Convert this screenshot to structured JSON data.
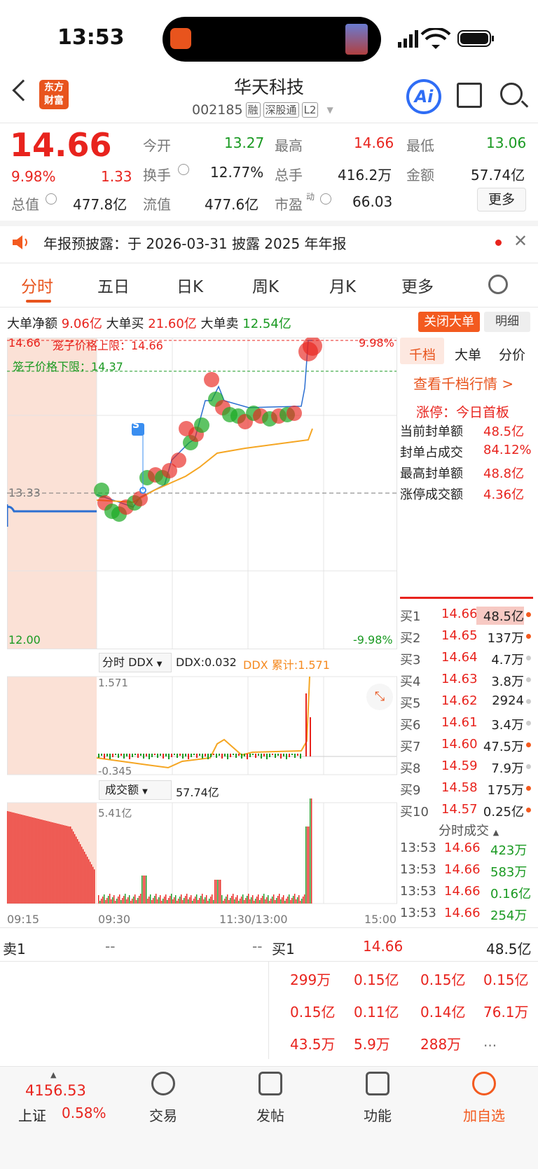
{
  "status": {
    "time": "13:53"
  },
  "header": {
    "title": "华天科技",
    "code": "002185",
    "tags": [
      "融",
      "深股通",
      "L2"
    ],
    "logo": "东方\n财富",
    "ai": "Ai"
  },
  "quote": {
    "price": "14.66",
    "pct": "9.98%",
    "chg": "1.33",
    "open_label": "今开",
    "open": "13.27",
    "high_label": "最高",
    "high": "14.66",
    "low_label": "最低",
    "low": "13.06",
    "turnover_label": "换手",
    "turnover": "12.77%",
    "vol_label": "总手",
    "vol": "416.2万",
    "amt_label": "金额",
    "amt": "57.74亿",
    "mcap_label": "总值",
    "mcap": "477.8亿",
    "float_label": "流值",
    "float": "477.6亿",
    "pe_label": "市盈",
    "pe_sup": "动",
    "pe": "66.03",
    "more": "更多"
  },
  "notice": "年报预披露：于 2026-03-31 披露 2025 年年报",
  "tabs": [
    "分时",
    "五日",
    "日K",
    "周K",
    "月K",
    "更多"
  ],
  "bigorder": {
    "net_label": "大单净额",
    "net": "9.06亿",
    "buy_label": "大单买",
    "buy": "21.60亿",
    "sell_label": "大单卖",
    "sell": "12.54亿",
    "close_btn": "关闭大单",
    "detail_btn": "明细"
  },
  "chart": {
    "top_price": "14.66",
    "top_pct": "9.98%",
    "cage_up": "笼子价格上限：14.66",
    "cage_low": "笼子价格下限：14.37",
    "mid": "13.33",
    "bottom_price": "12.00",
    "bottom_pct": "-9.98%",
    "s_marker": "S"
  },
  "ddx": {
    "label": "分时 DDX",
    "ddx": "DDX:0.032",
    "cum": "DDX 累计:1.571",
    "top": "1.571",
    "bottom": "-0.345"
  },
  "volume": {
    "label": "成交额",
    "amt": "57.74亿",
    "top": "5.41亿",
    "times": [
      "09:15",
      "09:30",
      "11:30/13:00",
      "15:00"
    ]
  },
  "right": {
    "tabs": [
      "千档",
      "大单",
      "分价"
    ],
    "link": "查看千档行情 >",
    "limit_label": "涨停：",
    "limit": "今日首板",
    "stats": [
      [
        "当前封单额",
        "48.5亿"
      ],
      [
        "封单占成交",
        "84.12%"
      ],
      [
        "最高封单额",
        "48.8亿"
      ],
      [
        "涨停成交额",
        "4.36亿"
      ]
    ],
    "bids": [
      [
        "买1",
        "14.66",
        "48.5亿"
      ],
      [
        "买2",
        "14.65",
        "137万"
      ],
      [
        "买3",
        "14.64",
        "4.7万"
      ],
      [
        "买4",
        "14.63",
        "3.8万"
      ],
      [
        "买5",
        "14.62",
        "2924"
      ],
      [
        "买6",
        "14.61",
        "3.4万"
      ],
      [
        "买7",
        "14.60",
        "47.5万"
      ],
      [
        "买8",
        "14.59",
        "7.9万"
      ],
      [
        "买9",
        "14.58",
        "175万"
      ],
      [
        "买10",
        "14.57",
        "0.25亿"
      ]
    ],
    "ticks_label": "分时成交",
    "ticks": [
      [
        "13:53",
        "14.66",
        "423万"
      ],
      [
        "13:53",
        "14.66",
        "583万"
      ],
      [
        "13:53",
        "14.66",
        "0.16亿"
      ],
      [
        "13:53",
        "14.66",
        "254万"
      ]
    ]
  },
  "bottom_book": {
    "sell1_label": "卖1",
    "sell1_price": "--",
    "sell1_vol": "--",
    "buy1_label": "买1",
    "buy1_price": "14.66",
    "buy1_vol": "48.5亿",
    "queue": [
      "299万",
      "0.15亿",
      "0.15亿",
      "0.15亿",
      "0.15亿",
      "0.11亿",
      "0.14亿",
      "76.1万",
      "43.5万",
      "5.9万",
      "288万",
      "..."
    ]
  },
  "nav": {
    "index_val": "4156.53",
    "index_name": "上证",
    "index_pct": "0.58%",
    "items": [
      "交易",
      "发帖",
      "功能",
      "加自选"
    ]
  }
}
